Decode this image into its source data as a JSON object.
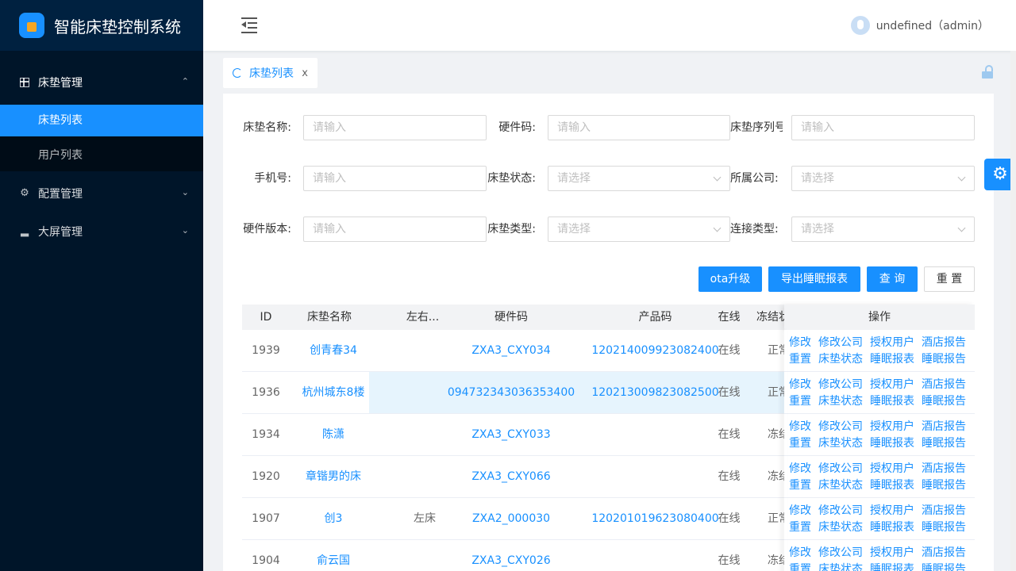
{
  "app": {
    "title": "智能床垫控制系统"
  },
  "header": {
    "user_label": "undefined（admin）"
  },
  "sidebar": {
    "items": [
      {
        "label": "床垫管理",
        "icon": "table-icon"
      },
      {
        "label": "配置管理",
        "icon": "gear-icon"
      },
      {
        "label": "大屏管理",
        "icon": "bar-chart-icon"
      }
    ],
    "submenu": [
      {
        "label": "床垫列表",
        "active": true
      },
      {
        "label": "用户列表",
        "active": false
      }
    ]
  },
  "tabs": [
    {
      "label": "床垫列表",
      "close": "x"
    }
  ],
  "form": {
    "mattress_name": {
      "label": "床垫名称:",
      "placeholder": "请输入"
    },
    "hardware_code": {
      "label": "硬件码:",
      "placeholder": "请输入"
    },
    "serial_no": {
      "label": "床垫序列号",
      "placeholder": "请输入"
    },
    "phone": {
      "label": "手机号:",
      "placeholder": "请输入"
    },
    "status": {
      "label": "床垫状态:",
      "placeholder": "请选择"
    },
    "company": {
      "label": "所属公司:",
      "placeholder": "请选择"
    },
    "hw_version": {
      "label": "硬件版本:",
      "placeholder": "请输入"
    },
    "type": {
      "label": "床垫类型:",
      "placeholder": "请选择"
    },
    "conn_type": {
      "label": "连接类型:",
      "placeholder": "请选择"
    }
  },
  "buttons": {
    "ota": "ota升级",
    "export": "导出睡眠报表",
    "query": "查 询",
    "reset": "重 置"
  },
  "table": {
    "headers": [
      "ID",
      "床垫名称",
      "左右...",
      "硬件码",
      "产品码",
      "在线",
      "冻结状",
      "操作"
    ],
    "rows": [
      {
        "id": "1939",
        "name": "创青春34",
        "side": "",
        "hw": "ZXA3_CXY034",
        "product": "120214009923082400",
        "online": "在线",
        "frozen": "正常"
      },
      {
        "id": "1936",
        "name": "杭州城东8楼",
        "side": "",
        "hw": "094732343036353400",
        "product": "120213009823082500",
        "online": "在线",
        "frozen": "正常"
      },
      {
        "id": "1934",
        "name": "陈潇",
        "side": "",
        "hw": "ZXA3_CXY033",
        "product": "",
        "online": "在线",
        "frozen": "冻结"
      },
      {
        "id": "1920",
        "name": "章锴男的床",
        "side": "",
        "hw": "ZXA3_CXY066",
        "product": "",
        "online": "在线",
        "frozen": "冻结"
      },
      {
        "id": "1907",
        "name": "创3",
        "side": "左床",
        "hw": "ZXA2_000030",
        "product": "120201019623080400",
        "online": "在线",
        "frozen": "正常"
      },
      {
        "id": "1904",
        "name": "俞云国",
        "side": "",
        "hw": "ZXA3_CXY026",
        "product": "",
        "online": "在线",
        "frozen": "冻结"
      }
    ],
    "actions_row1": [
      "修改",
      "修改公司",
      "授权用户",
      "酒店报告"
    ],
    "actions_row2": [
      "重置",
      "床垫状态",
      "睡眠报表",
      "睡眠报告"
    ]
  }
}
